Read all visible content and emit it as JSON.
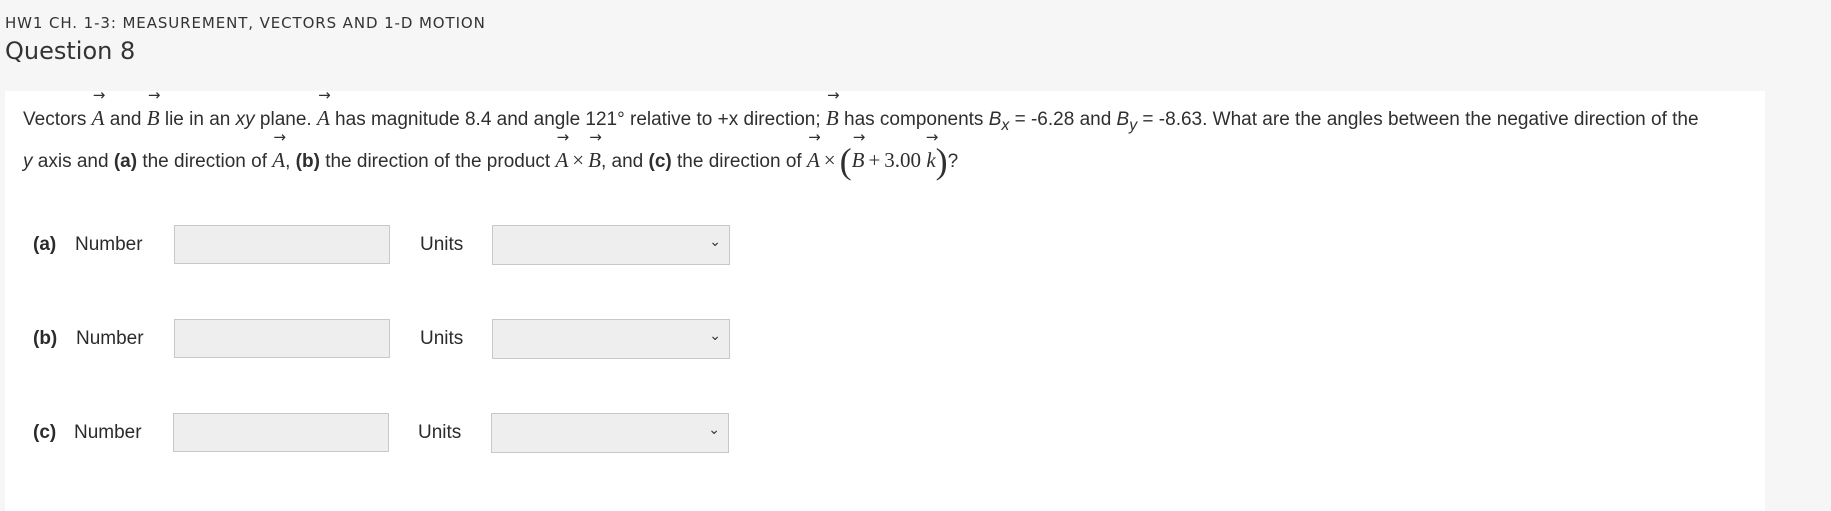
{
  "course_title": "HW1 CH. 1-3: MEASUREMENT, VECTORS AND 1-D MOTION",
  "question_title": "Question 8",
  "problem": {
    "t1": "Vectors ",
    "vA": "A",
    "t2": " and ",
    "vB": "B",
    "t3": " lie in an ",
    "xy": "xy",
    "t4": " plane. ",
    "t5": " has magnitude 8.4 and angle 121° relative to +x direction; ",
    "t6": " has components ",
    "Bsym": "B",
    "xsub": "x",
    "t7": " = -6.28 and ",
    "ysub": "y",
    "t8": " = -8.63. What are the angles between the negative direction of the",
    "y": "y",
    "t9": " axis and ",
    "pa": "(a)",
    "t10": " the direction of ",
    "t11": ", ",
    "pb": "(b)",
    "t12": " the direction of the product ",
    "cross": "×",
    "t13": ", and ",
    "pc": "(c)",
    "t14": " the direction of ",
    "plus": "+",
    "coef": "3.00",
    "vk": "k",
    "lparen": "(",
    "rparen": ")",
    "t15": "?",
    "arrow": "→"
  },
  "answers": [
    {
      "part": "(a)",
      "number_label": "Number",
      "units_label": "Units",
      "number_value": "",
      "units_value": ""
    },
    {
      "part": "(b)",
      "number_label": "Number",
      "units_label": "Units",
      "number_value": "",
      "units_value": ""
    },
    {
      "part": "(c)",
      "number_label": "Number",
      "units_label": "Units",
      "number_value": "",
      "units_value": ""
    }
  ],
  "icons": {
    "dropdown": "chevron-down-icon"
  }
}
